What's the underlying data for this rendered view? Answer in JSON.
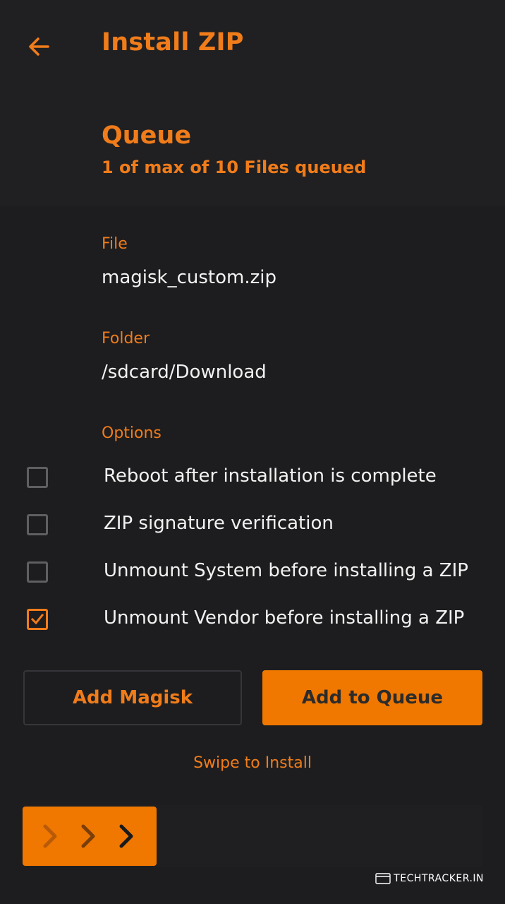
{
  "header": {
    "title": "Install ZIP",
    "back_icon": "arrow-left-icon"
  },
  "queue": {
    "title": "Queue",
    "subtitle": "1 of max of 10 Files queued"
  },
  "file": {
    "label": "File",
    "value": "magisk_custom.zip"
  },
  "folder": {
    "label": "Folder",
    "value": "/sdcard/Download"
  },
  "options": {
    "label": "Options",
    "items": [
      {
        "label": "Reboot after installation is complete",
        "checked": false
      },
      {
        "label": "ZIP signature verification",
        "checked": false
      },
      {
        "label": "Unmount System before installing a ZIP",
        "checked": false
      },
      {
        "label": "Unmount Vendor before installing a ZIP",
        "checked": true
      }
    ]
  },
  "buttons": {
    "add_magisk": "Add Magisk",
    "add_to_queue": "Add to Queue"
  },
  "swipe": {
    "label": "Swipe to Install",
    "icon": "triple-chevron-right-icon"
  },
  "watermark": {
    "text": "TECHTRACKER.IN"
  },
  "colors": {
    "accent": "#f07c1a",
    "background": "#1d1d1f",
    "text": "#f2f2f2"
  }
}
